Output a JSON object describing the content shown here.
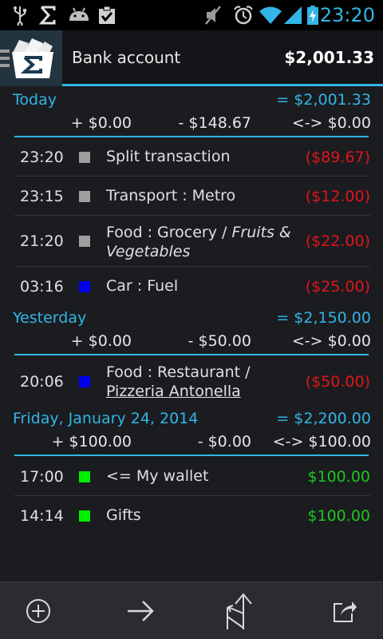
{
  "status_bar": {
    "time": "23:20",
    "icons": [
      "usb-icon",
      "sigma-icon",
      "android-icon",
      "checkbox-icon",
      "mute-icon",
      "alarm-icon",
      "wifi-icon",
      "signal-icon",
      "battery-charging-icon"
    ]
  },
  "action_bar": {
    "account_name": "Bank account",
    "balance": "$2,001.33"
  },
  "days": [
    {
      "title": "Today",
      "total": "= $2,001.33",
      "income": "+ $0.00",
      "expense": "- $148.67",
      "transfer": "<-> $0.00",
      "transactions": [
        {
          "time": "23:20",
          "label": "Split transaction",
          "amount": "($89.67)",
          "color": "#9e9e9e",
          "sign": "neg"
        },
        {
          "time": "23:15",
          "label": "Transport : Metro",
          "amount": "($12.00)",
          "color": "#9e9e9e",
          "sign": "neg"
        },
        {
          "time": "21:20",
          "label": "Food : Grocery / ",
          "label_italic": "Fruits & Vegetables",
          "amount": "($22.00)",
          "color": "#9e9e9e",
          "sign": "neg"
        },
        {
          "time": "03:16",
          "label": "Car : Fuel",
          "amount": "($25.00)",
          "color": "#0000ee",
          "sign": "neg"
        }
      ]
    },
    {
      "title": "Yesterday",
      "total": "= $2,150.00",
      "income": "+ $0.00",
      "expense": "- $50.00",
      "transfer": "<-> $0.00",
      "transactions": [
        {
          "time": "20:06",
          "label": "Food : Restaurant /",
          "label_underline": "Pizzeria Antonella",
          "amount": "($50.00)",
          "color": "#0000ee",
          "sign": "neg"
        }
      ]
    },
    {
      "title": "Friday, January 24, 2014",
      "total": "= $2,200.00",
      "income": "+ $100.00",
      "expense": "- $0.00",
      "transfer": "<-> $100.00",
      "transactions": [
        {
          "time": "17:00",
          "label": "<= My wallet",
          "amount": "$100.00",
          "color": "#00ee00",
          "sign": "pos"
        },
        {
          "time": "14:14",
          "label": "Gifts",
          "amount": "$100.00",
          "color": "#00ee00",
          "sign": "pos"
        }
      ]
    }
  ],
  "bottom_bar": {
    "buttons": [
      "add-icon",
      "transfer-icon",
      "split-icon",
      "export-icon"
    ]
  },
  "colors": {
    "accent": "#33b5e5",
    "negative": "#e0151b",
    "positive": "#1fc61c"
  }
}
